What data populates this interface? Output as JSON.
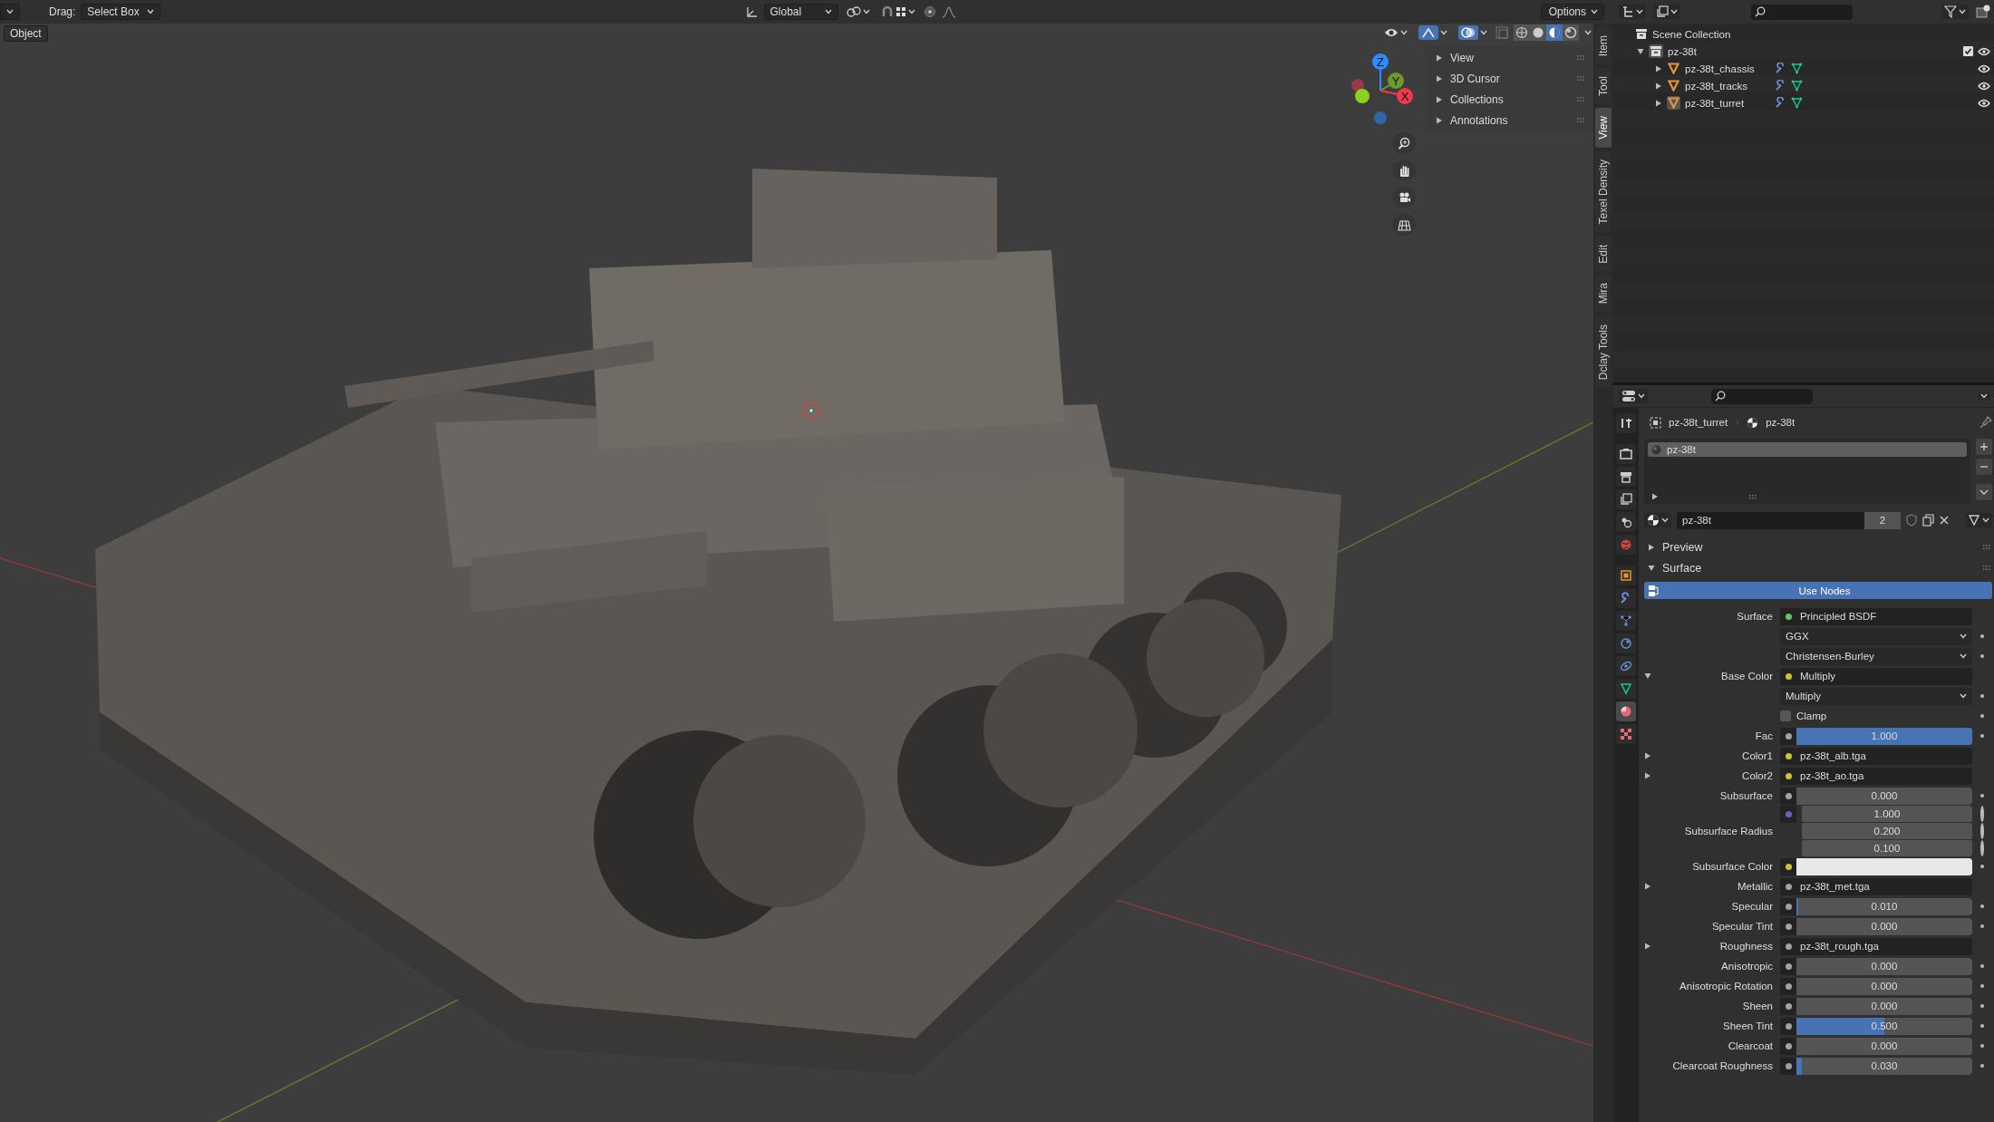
{
  "header": {
    "drag_label": "Drag:",
    "drag_mode": "Select Box",
    "orientation": "Global",
    "options": "Options"
  },
  "viewport": {
    "mode": "Object",
    "shading": [
      {
        "kind": "wireframe",
        "selected": false
      },
      {
        "kind": "solid",
        "selected": false
      },
      {
        "kind": "material",
        "selected": true
      },
      {
        "kind": "rendered",
        "selected": false
      }
    ],
    "gizmo_axes": [
      {
        "label": "Z",
        "color": "#2b8cff"
      },
      {
        "label": "Y",
        "color": "#6d9a2b"
      },
      {
        "label": "X",
        "color": "#f0384f"
      }
    ],
    "sidebar_panels": [
      {
        "label": "View",
        "expanded": false
      },
      {
        "label": "3D Cursor",
        "expanded": false
      },
      {
        "label": "Collections",
        "expanded": false
      },
      {
        "label": "Annotations",
        "expanded": false
      }
    ],
    "sidebar_tabs": [
      {
        "label": "Item",
        "selected": false
      },
      {
        "label": "Tool",
        "selected": false
      },
      {
        "label": "View",
        "selected": true
      },
      {
        "label": "Texel Density",
        "selected": false
      },
      {
        "label": "Edit",
        "selected": false
      },
      {
        "label": "Mira",
        "selected": false
      },
      {
        "label": "Dclay Tools",
        "selected": false
      }
    ]
  },
  "outliner": {
    "root": "Scene Collection",
    "collections": [
      {
        "label": "pz-38t",
        "expanded": true,
        "checked": true,
        "children": [
          {
            "label": "pz-38t_chassis",
            "expanded": false,
            "selected": false
          },
          {
            "label": "pz-38t_tracks",
            "expanded": false,
            "selected": false
          },
          {
            "label": "pz-38t_turret",
            "expanded": false,
            "selected": true
          }
        ]
      }
    ]
  },
  "properties": {
    "tabs": [
      {
        "kind": "tool",
        "selected": false
      },
      {
        "kind": "render",
        "selected": false
      },
      {
        "kind": "output",
        "selected": false
      },
      {
        "kind": "view_layer",
        "selected": false
      },
      {
        "kind": "scene",
        "selected": false
      },
      {
        "kind": "world",
        "selected": false
      },
      {
        "kind": "object",
        "selected": false
      },
      {
        "kind": "modifiers",
        "selected": false
      },
      {
        "kind": "particles",
        "selected": false
      },
      {
        "kind": "physics",
        "selected": false
      },
      {
        "kind": "constraints",
        "selected": false
      },
      {
        "kind": "data",
        "selected": false
      },
      {
        "kind": "material",
        "selected": true
      },
      {
        "kind": "texture",
        "selected": false
      }
    ],
    "breadcrumb": {
      "object": "pz-38t_turret",
      "material": "pz-38t"
    },
    "slots": [
      {
        "label": "pz-38t",
        "selected": true
      }
    ],
    "material": {
      "name": "pz-38t",
      "users": "2"
    },
    "panels": [
      {
        "label": "Preview",
        "expanded": false
      },
      {
        "label": "Surface",
        "expanded": true
      }
    ],
    "use_nodes": "Use Nodes",
    "rows": [
      {
        "kind": "link",
        "label": "Surface",
        "socket": {
          "color": "#63c763"
        },
        "value": "Principled BSDF"
      },
      {
        "kind": "dropdown",
        "value": "GGX"
      },
      {
        "kind": "dropdown",
        "value": "Christensen-Burley"
      },
      {
        "kind": "link",
        "label": "Base Color",
        "socket": {
          "color": "#c7c729"
        },
        "value": "Multiply",
        "expanded": true
      },
      {
        "kind": "dropdown",
        "value": "Multiply"
      },
      {
        "kind": "checkbox",
        "label": "Clamp",
        "checked": false
      },
      {
        "kind": "slider",
        "label": "Fac",
        "socket": {
          "color": "#a1a1a1"
        },
        "value": "1.000",
        "level": 1
      },
      {
        "kind": "link",
        "label": "Color1",
        "socket": {
          "color": "#c7c729"
        },
        "value": "pz-38t_alb.tga",
        "expanded": false
      },
      {
        "kind": "link",
        "label": "Color2",
        "socket": {
          "color": "#c7c729"
        },
        "value": "pz-38t_ao.tga",
        "expanded": false
      },
      {
        "kind": "slider",
        "label": "Subsurface",
        "socket": {
          "color": "#a1a1a1"
        },
        "value": "0.000",
        "level": 0
      },
      {
        "kind": "vector",
        "label": "Subsurface Radius",
        "socket": {
          "color": "#6363c7"
        },
        "values": [
          "1.000",
          "0.200",
          "0.100"
        ]
      },
      {
        "kind": "color",
        "label": "Subsurface Color",
        "socket": {
          "color": "#c7c729"
        },
        "color": "#e8e8e8"
      },
      {
        "kind": "link",
        "label": "Metallic",
        "socket": {
          "color": "#a1a1a1"
        },
        "value": "pz-38t_met.tga",
        "expanded": false
      },
      {
        "kind": "slider",
        "label": "Specular",
        "socket": {
          "color": "#a1a1a1"
        },
        "value": "0.010",
        "level": 0.01
      },
      {
        "kind": "slider",
        "label": "Specular Tint",
        "socket": {
          "color": "#a1a1a1"
        },
        "value": "0.000",
        "level": 0
      },
      {
        "kind": "link",
        "label": "Roughness",
        "socket": {
          "color": "#a1a1a1"
        },
        "value": "pz-38t_rough.tga",
        "expanded": false
      },
      {
        "kind": "slider",
        "label": "Anisotropic",
        "socket": {
          "color": "#a1a1a1"
        },
        "value": "0.000",
        "level": 0
      },
      {
        "kind": "slider",
        "label": "Anisotropic Rotation",
        "socket": {
          "color": "#a1a1a1"
        },
        "value": "0.000",
        "level": 0
      },
      {
        "kind": "slider",
        "label": "Sheen",
        "socket": {
          "color": "#a1a1a1"
        },
        "value": "0.000",
        "level": 0
      },
      {
        "kind": "slider",
        "label": "Sheen Tint",
        "socket": {
          "color": "#a1a1a1"
        },
        "value": "0.500",
        "level": 0.5
      },
      {
        "kind": "slider",
        "label": "Clearcoat",
        "socket": {
          "color": "#a1a1a1"
        },
        "value": "0.000",
        "level": 0
      },
      {
        "kind": "slider",
        "label": "Clearcoat Roughness",
        "socket": {
          "color": "#a1a1a1"
        },
        "value": "0.030",
        "level": 0.03
      }
    ]
  }
}
